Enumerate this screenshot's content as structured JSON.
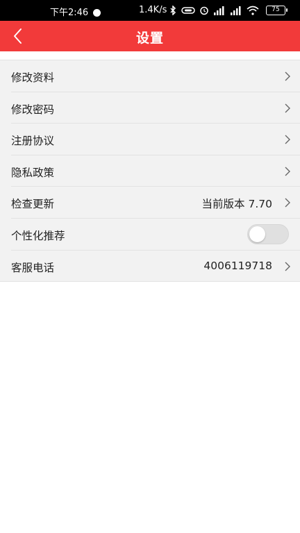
{
  "status_bar": {
    "time": "下午2:46",
    "network_speed": "1.4K/s",
    "battery_level": "75",
    "icons": [
      "bluetooth-icon",
      "link-icon",
      "alarm-icon",
      "signal-hd-icon",
      "signal-hd-icon",
      "wifi-icon",
      "battery-icon"
    ]
  },
  "nav": {
    "title": "设置",
    "back_icon": "chevron-left-icon",
    "background": "#f23a3a"
  },
  "settings": {
    "edit_profile": "修改资料",
    "change_password": "修改密码",
    "registration_agreement": "注册协议",
    "privacy_policy": "隐私政策",
    "check_update": "检查更新",
    "current_version": "当前版本 7.70",
    "personalized_recommendation": "个性化推荐",
    "personalized_recommendation_on": false,
    "customer_service": "客服电话",
    "customer_service_phone": "4006119718"
  }
}
